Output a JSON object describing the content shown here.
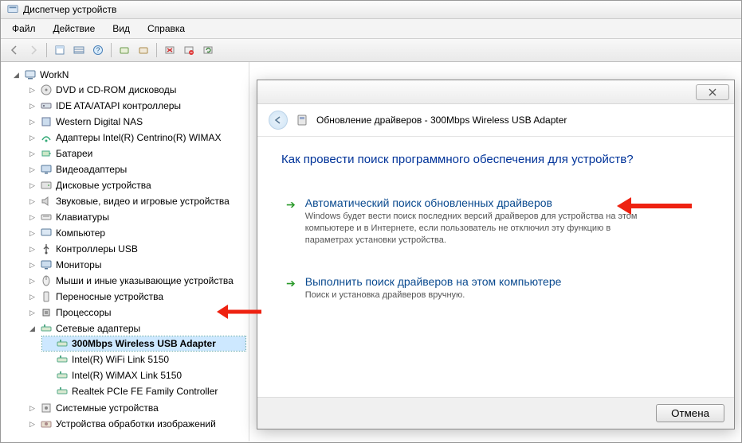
{
  "window": {
    "title": "Диспетчер устройств"
  },
  "menu": {
    "file": "Файл",
    "action": "Действие",
    "view": "Вид",
    "help": "Справка"
  },
  "tree": {
    "root": "WorkN",
    "items": [
      "DVD и CD-ROM дисководы",
      "IDE ATA/ATAPI контроллеры",
      "Western Digital NAS",
      "Адаптеры Intel(R) Centrino(R) WIMAX",
      "Батареи",
      "Видеоадаптеры",
      "Дисковые устройства",
      "Звуковые, видео и игровые устройства",
      "Клавиатуры",
      "Компьютер",
      "Контроллеры USB",
      "Мониторы",
      "Мыши и иные указывающие устройства",
      "Переносные устройства",
      "Процессоры",
      "Сетевые адаптеры",
      "Системные устройства",
      "Устройства обработки изображений"
    ],
    "network_children": [
      "300Mbps Wireless USB Adapter",
      "Intel(R) WiFi Link 5150",
      "Intel(R) WiMAX Link 5150",
      "Realtek PCIe FE Family Controller"
    ]
  },
  "dialog": {
    "title": "Обновление драйверов - 300Mbps Wireless USB Adapter",
    "question": "Как провести поиск программного обеспечения для устройств?",
    "opt1_title": "Автоматический поиск обновленных драйверов",
    "opt1_desc": "Windows будет вести поиск последних версий драйверов для устройства на этом компьютере и в Интернете, если пользователь не отключил эту функцию в параметрах установки устройства.",
    "opt2_title": "Выполнить поиск драйверов на этом компьютере",
    "opt2_desc": "Поиск и установка драйверов вручную.",
    "cancel": "Отмена"
  }
}
